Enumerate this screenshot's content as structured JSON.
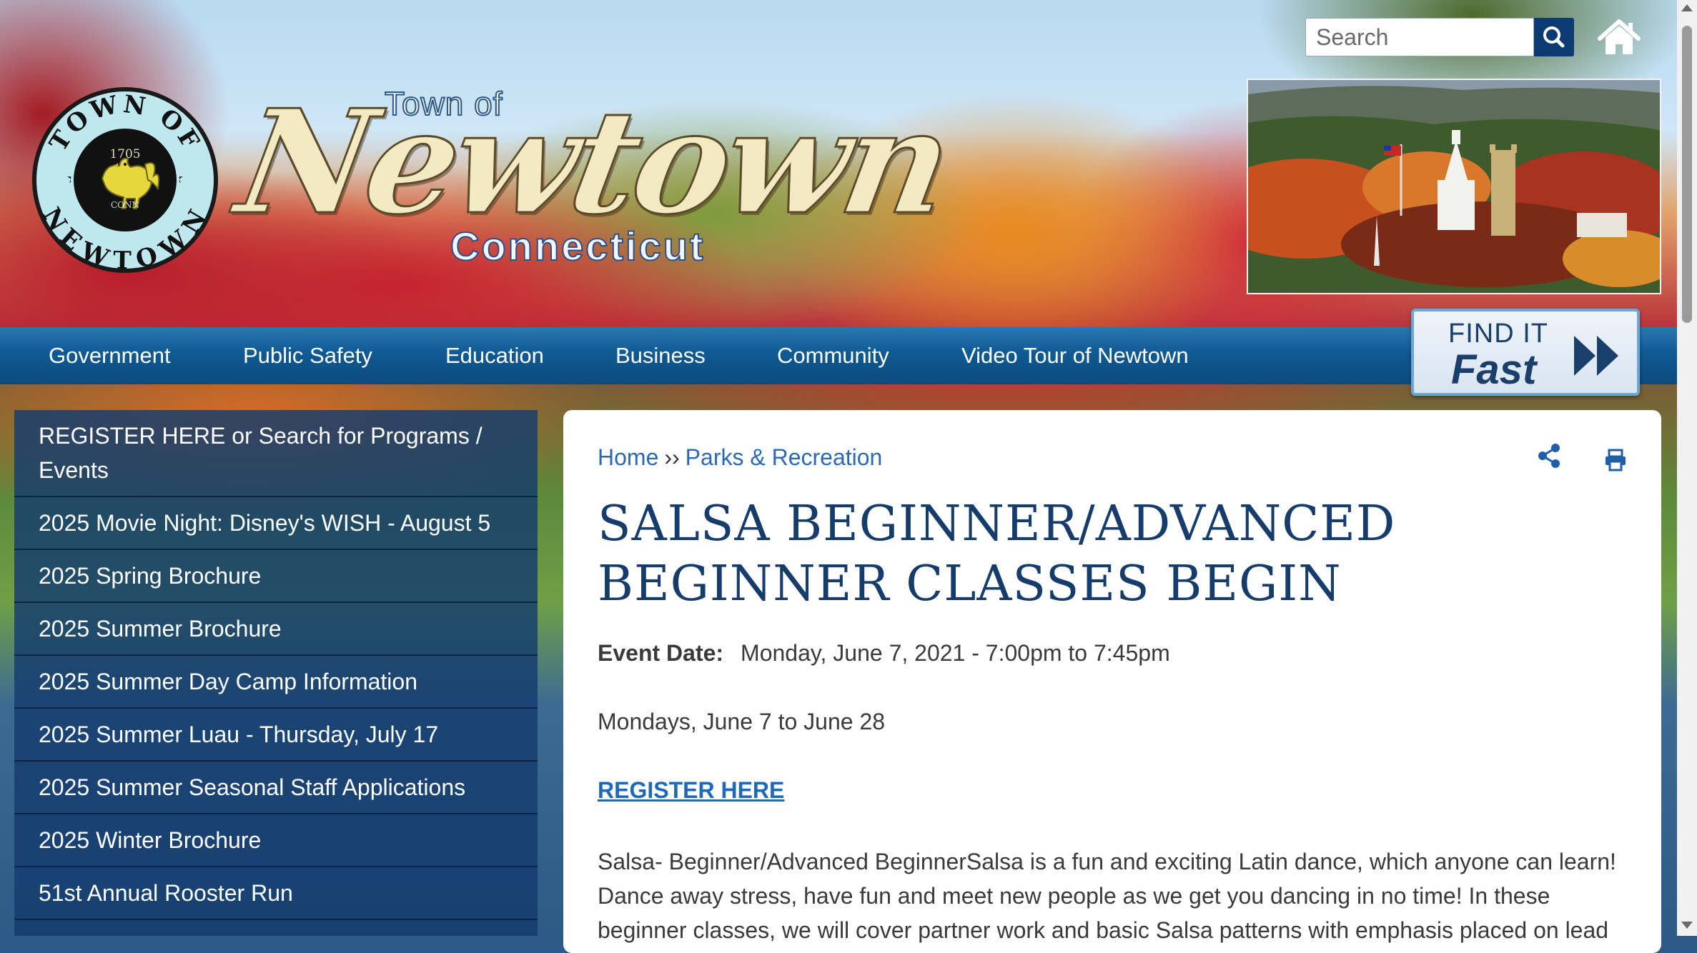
{
  "header": {
    "logo": {
      "seal_ring_text_top": "TOWN OF",
      "seal_ring_text_bottom": "NEWTOWN",
      "seal_year": "1705",
      "seal_inner_text": "CONN",
      "wordmark_prefix": "Town of",
      "wordmark_name": "Newtown",
      "wordmark_state": "Connecticut"
    },
    "search": {
      "placeholder": "Search",
      "value": ""
    },
    "icons": {
      "search": "search-icon",
      "home": "home-icon"
    }
  },
  "nav": {
    "items": [
      {
        "label": "Government"
      },
      {
        "label": "Public Safety"
      },
      {
        "label": "Education"
      },
      {
        "label": "Business"
      },
      {
        "label": "Community"
      },
      {
        "label": "Video Tour of Newtown"
      }
    ],
    "find_it_fast": {
      "line1": "FIND IT",
      "line2": "Fast"
    }
  },
  "sidebar": {
    "items": [
      {
        "label": "REGISTER HERE or Search for Programs / Events"
      },
      {
        "label": "2025 Movie Night: Disney's WISH - August 5"
      },
      {
        "label": "2025 Spring Brochure"
      },
      {
        "label": "2025 Summer Brochure"
      },
      {
        "label": "2025 Summer Day Camp Information"
      },
      {
        "label": "2025 Summer Luau - Thursday, July 17"
      },
      {
        "label": "2025 Summer Seasonal Staff Applications"
      },
      {
        "label": "2025 Winter Brochure"
      },
      {
        "label": "51st Annual Rooster Run"
      }
    ]
  },
  "content": {
    "breadcrumb": {
      "home": "Home",
      "separator": "››",
      "section": "Parks & Recreation"
    },
    "tools": {
      "share": "share-icon",
      "print": "print-icon"
    },
    "title": "SALSA BEGINNER/ADVANCED BEGINNER CLASSES BEGIN",
    "event_label": "Event Date:",
    "event_value": "Monday, June 7, 2021 - 7:00pm to 7:45pm",
    "dates_text": "Mondays, June 7 to June 28",
    "register_link": "REGISTER HERE",
    "description": "Salsa- Beginner/Advanced BeginnerSalsa is a fun and exciting Latin dance, which anyone can learn! Dance away stress, have fun and meet new people as we get you dancing in no time! In these beginner classes, we will cover partner work and basic Salsa patterns with emphasis placed on lead"
  },
  "colors": {
    "nav_blue": "#0f5a93",
    "title_navy": "#163c6b",
    "link_blue": "#2b69b4",
    "search_button": "#0c3b74"
  }
}
